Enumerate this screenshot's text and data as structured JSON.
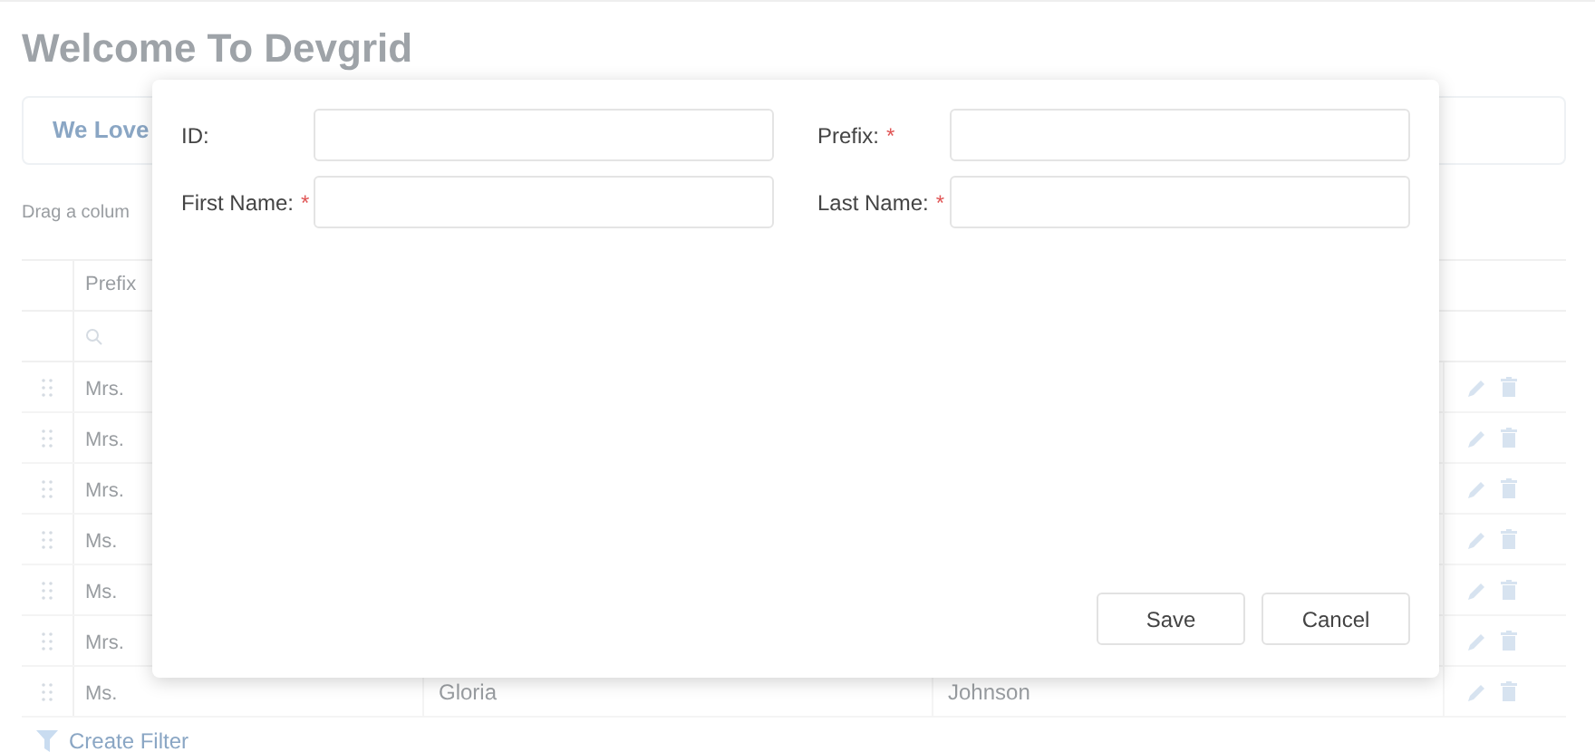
{
  "page": {
    "title": "Welcome To Devgrid",
    "banner": "We Love",
    "group_hint": "Drag a colum"
  },
  "grid": {
    "columns": [
      "Prefix"
    ],
    "rows": [
      {
        "prefix": "Mrs.",
        "first_name": "",
        "last_name": ""
      },
      {
        "prefix": "Mrs.",
        "first_name": "",
        "last_name": ""
      },
      {
        "prefix": "Mrs.",
        "first_name": "",
        "last_name": ""
      },
      {
        "prefix": "Ms.",
        "first_name": "",
        "last_name": ""
      },
      {
        "prefix": "Ms.",
        "first_name": "",
        "last_name": ""
      },
      {
        "prefix": "Mrs.",
        "first_name": "",
        "last_name": ""
      },
      {
        "prefix": "Ms.",
        "first_name": "Gloria",
        "last_name": "Johnson"
      }
    ],
    "create_filter": "Create Filter"
  },
  "dialog": {
    "fields": [
      {
        "label": "ID:",
        "required": false
      },
      {
        "label": "Prefix:",
        "required": true
      },
      {
        "label": "First Name:",
        "required": true
      },
      {
        "label": "Last Name:",
        "required": true
      }
    ],
    "required_mark": "*",
    "buttons": [
      "Save",
      "Cancel"
    ]
  }
}
